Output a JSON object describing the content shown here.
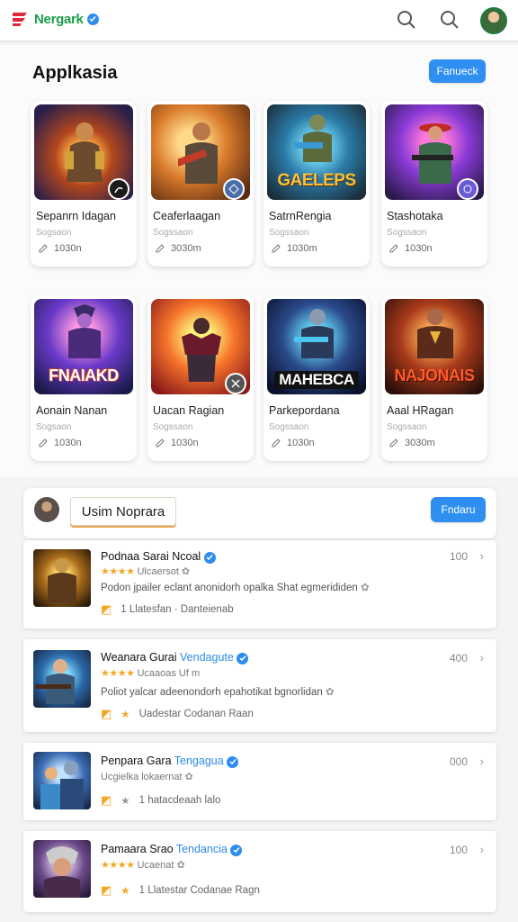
{
  "header": {
    "brand": "Nergark",
    "icons": [
      "search-icon",
      "search-icon",
      "avatar"
    ]
  },
  "apps": {
    "title": "Applkasia",
    "action_label": "Fanueck",
    "items": [
      {
        "name": "Sepanrn Idagan",
        "sub": "Sogsaon",
        "meta": "1030n",
        "logo": ""
      },
      {
        "name": "Ceaferlaagan",
        "sub": "Sogssaon",
        "meta": "3030m",
        "logo": ""
      },
      {
        "name": "SatrnRengia",
        "sub": "Sogssaon",
        "meta": "1030m",
        "logo": "GAELEPS"
      },
      {
        "name": "Stashotaka",
        "sub": "Sogssaon",
        "meta": "1030n",
        "logo": ""
      },
      {
        "name": "Aonain Nanan",
        "sub": "Sogsaon",
        "meta": "1030n",
        "logo": "FNAIAKD"
      },
      {
        "name": "Uacan Ragian",
        "sub": "Sogssaon",
        "meta": "1030n",
        "logo": ""
      },
      {
        "name": "Parkepordana",
        "sub": "Sogssaon",
        "meta": "1030n",
        "logo": "MAHEBCA"
      },
      {
        "name": "Aaal HRagan",
        "sub": "Sogssaon",
        "meta": "3030m",
        "logo": "NAJONAIS"
      }
    ]
  },
  "list": {
    "title": "Usim Noprara",
    "action_label": "Fndaru",
    "items": [
      {
        "title": "Podnaa Sarai Ncoal",
        "accent": "",
        "stars": "★★★★",
        "line2": "Ulcaersot",
        "desc": "Podon jpailer eclant anonidorh opalka Shat egmerididen",
        "meta1": "1 Llatesfan · Danteienab",
        "meta2": "",
        "count": "100"
      },
      {
        "title": "Weanara Gurai",
        "accent": "Vendagute",
        "stars": "★★★★",
        "line2": "Ucaaoas Uf m",
        "desc": "Poliot yalcar adeenondorh epahotikat bgnorlidan",
        "meta1": "Uadestar Codanan Raan",
        "meta2": "",
        "count": "400"
      },
      {
        "title": "Penpara Gara",
        "accent": "Tengagua",
        "stars": "",
        "line2": "Ucgielka lokaernat",
        "desc": "",
        "meta1": "1 hatacdeaah lalo",
        "meta2": "",
        "count": "000"
      },
      {
        "title": "Pamaara Srao",
        "accent": "Tendancia",
        "stars": "★★★★",
        "line2": "Ucaenat",
        "desc": "",
        "meta1": "1 Llatestar Codanae Ragn",
        "meta2": "",
        "count": "100"
      }
    ]
  },
  "colors": {
    "primary": "#2f8ff0",
    "brand_green": "#1a9e4a",
    "star": "#f5a623"
  }
}
